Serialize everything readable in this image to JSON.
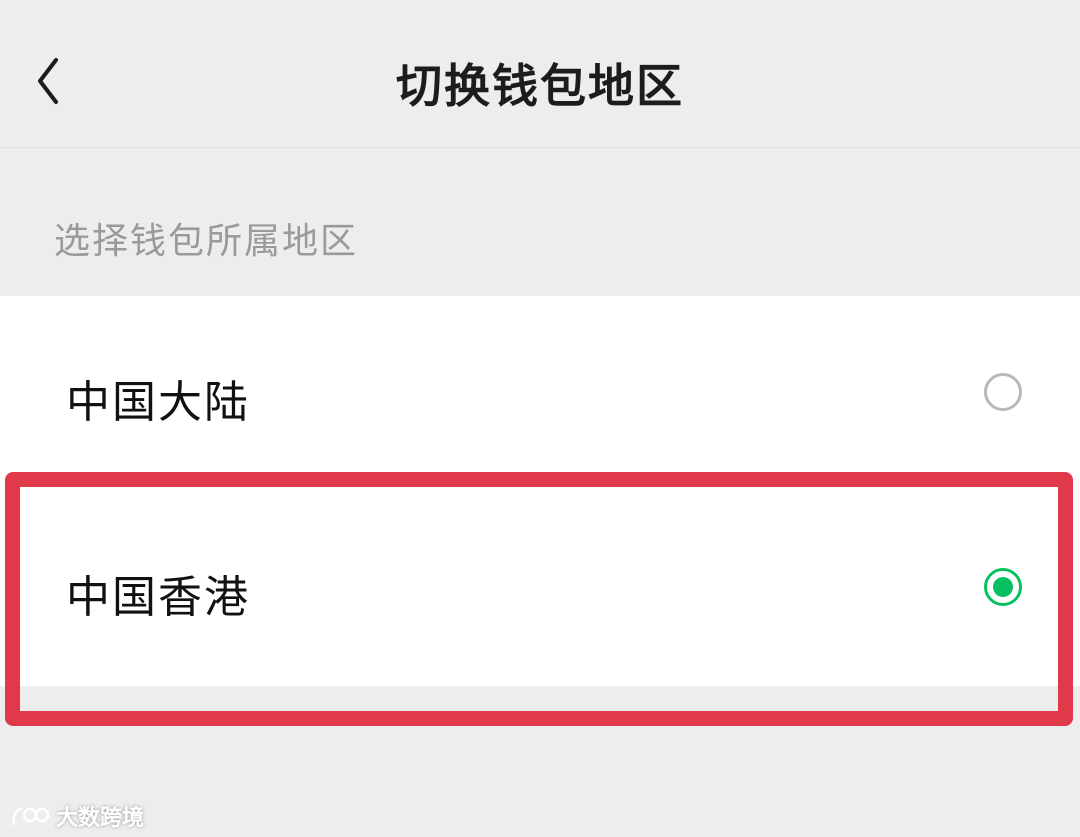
{
  "header": {
    "title": "切换钱包地区",
    "back_icon": "chevron-left-icon"
  },
  "section": {
    "label": "选择钱包所属地区"
  },
  "options": [
    {
      "label": "中国大陆",
      "selected": false
    },
    {
      "label": "中国香港",
      "selected": true
    }
  ],
  "colors": {
    "accent": "#07c160",
    "highlight": "#e03a4a",
    "background": "#ededed"
  },
  "watermark": {
    "text": "大数跨境"
  }
}
